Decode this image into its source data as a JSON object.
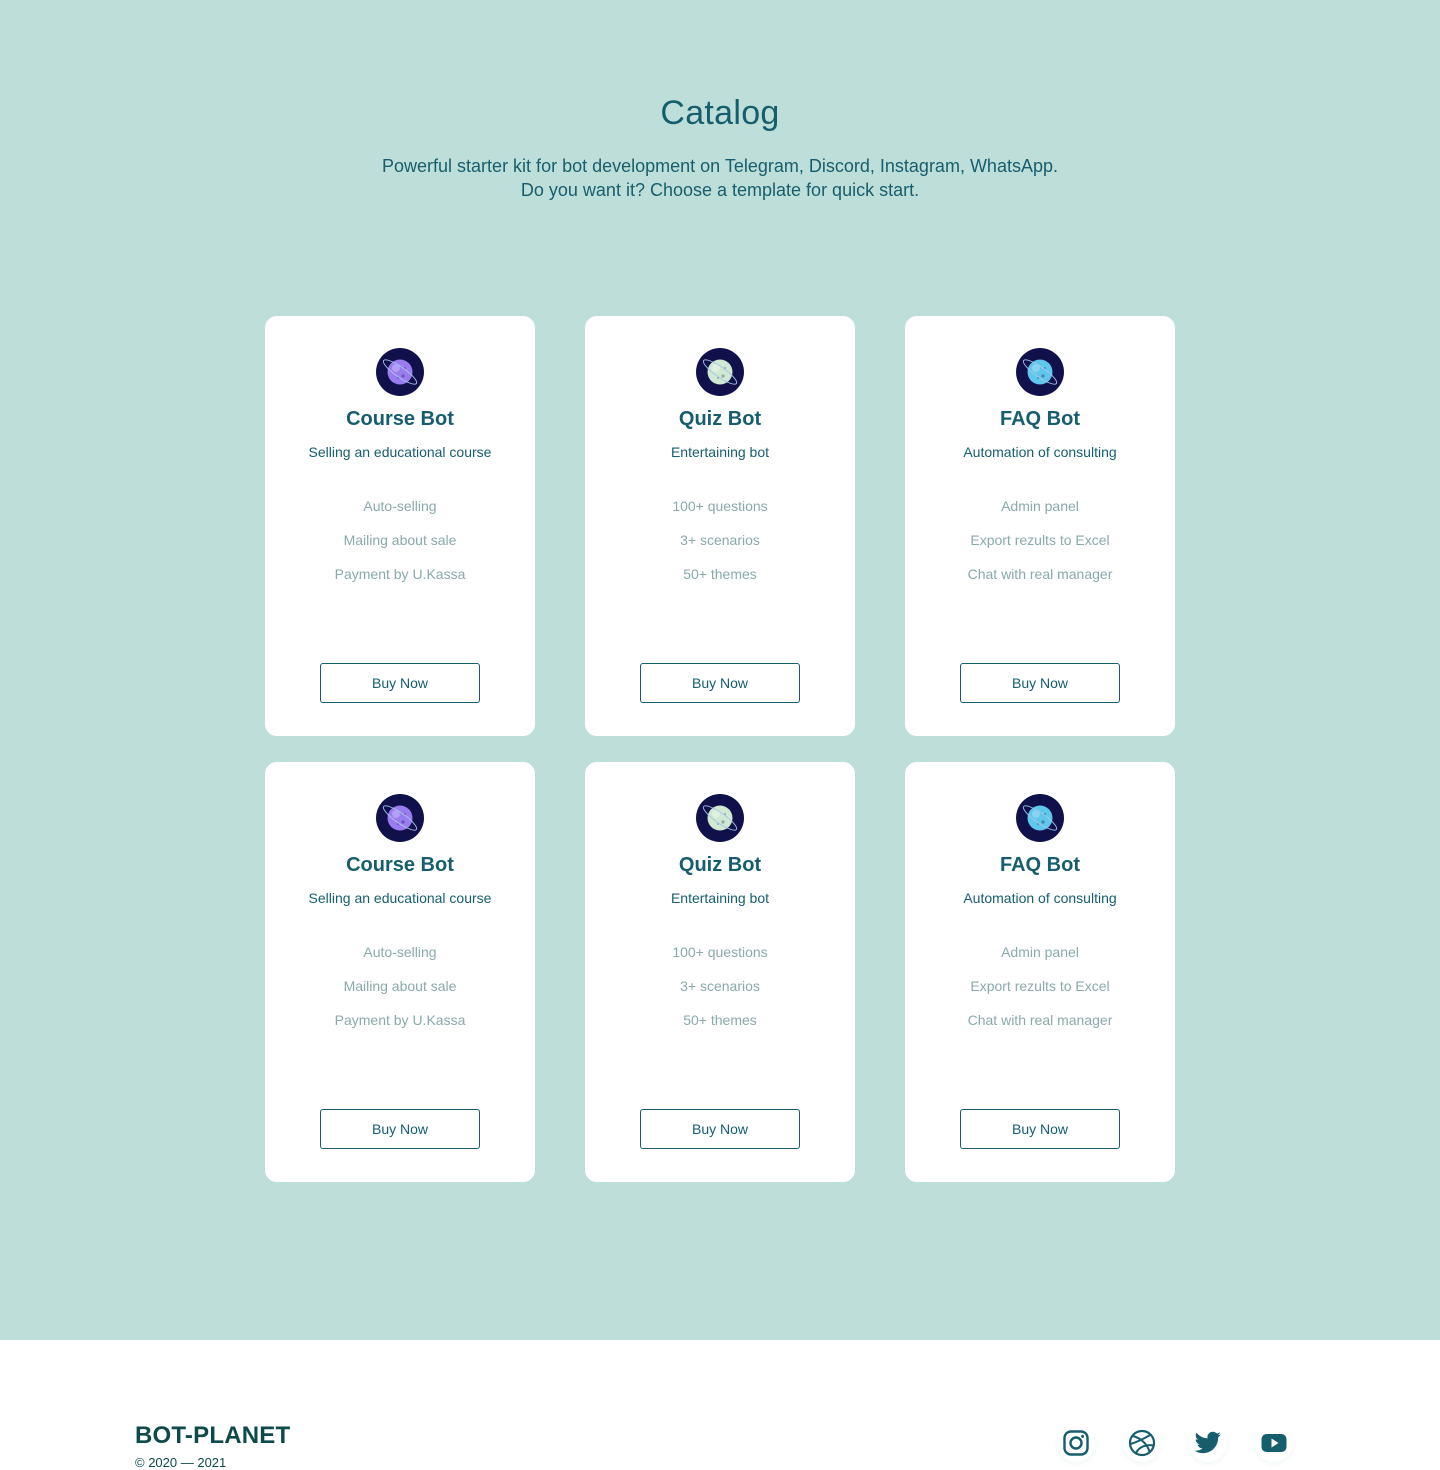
{
  "catalog": {
    "title": "Catalog",
    "subtitle_line1": "Powerful starter kit for bot development on Telegram, Discord, Instagram, WhatsApp.",
    "subtitle_line2": "Do you want it? Choose a template for quick start."
  },
  "cards": [
    {
      "icon": "purple-planet-icon",
      "planet_color": "#9b7cf0",
      "title": "Course Bot",
      "description": "Selling an educational course",
      "features": [
        "Auto-selling",
        "Mailing about sale",
        "Payment by U.Kassa"
      ],
      "button": "Buy Now"
    },
    {
      "icon": "green-planet-icon",
      "planet_color": "#cfe9d2",
      "title": "Quiz Bot",
      "description": "Entertaining bot",
      "features": [
        "100+ questions",
        "3+ scenarios",
        "50+ themes"
      ],
      "button": "Buy Now"
    },
    {
      "icon": "blue-planet-icon",
      "planet_color": "#5fc6ec",
      "title": "FAQ Bot",
      "description": "Automation of consulting",
      "features": [
        "Admin panel",
        "Export rezults to Excel",
        "Chat with real manager"
      ],
      "button": "Buy Now"
    },
    {
      "icon": "purple-planet-icon",
      "planet_color": "#9b7cf0",
      "title": "Course Bot",
      "description": "Selling an educational course",
      "features": [
        "Auto-selling",
        "Mailing about sale",
        "Payment by U.Kassa"
      ],
      "button": "Buy Now"
    },
    {
      "icon": "green-planet-icon",
      "planet_color": "#cfe9d2",
      "title": "Quiz Bot",
      "description": "Entertaining bot",
      "features": [
        "100+ questions",
        "3+ scenarios",
        "50+ themes"
      ],
      "button": "Buy Now"
    },
    {
      "icon": "blue-planet-icon",
      "planet_color": "#5fc6ec",
      "title": "FAQ Bot",
      "description": "Automation of consulting",
      "features": [
        "Admin panel",
        "Export rezults to Excel",
        "Chat with real manager"
      ],
      "button": "Buy Now"
    }
  ],
  "footer": {
    "brand": "BOT-PLANET",
    "copyright": "© 2020 — 2021",
    "social": [
      "instagram-icon",
      "dribbble-icon",
      "twitter-icon",
      "youtube-icon"
    ]
  },
  "colors": {
    "background": "#bedfd9",
    "primary": "#165e6e",
    "muted": "#8aa9ac",
    "planet_bg": "#10114a"
  }
}
